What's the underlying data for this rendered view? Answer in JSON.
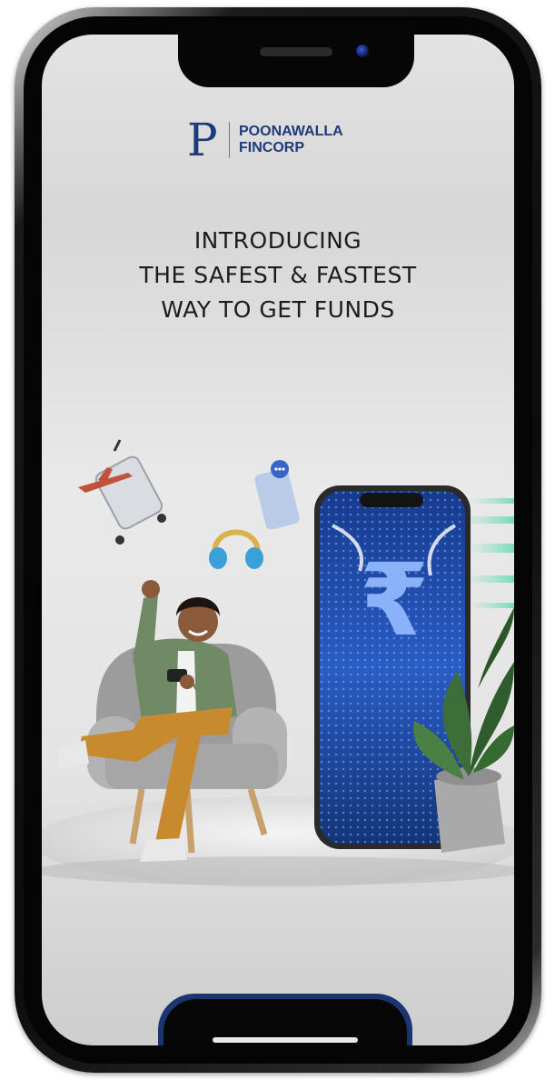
{
  "brand": {
    "mark": "P",
    "name_line1": "POONAWALLA",
    "name_line2": "FINCORP"
  },
  "headline": {
    "line1": "INTRODUCING",
    "line2": "THE SAFEST & FASTEST",
    "line3": "WAY TO GET FUNDS"
  },
  "illustration": {
    "phone_symbol": "₹"
  },
  "colors": {
    "brand_blue": "#1f3a7a",
    "phone_screen_blue": "#1d4aa8"
  }
}
